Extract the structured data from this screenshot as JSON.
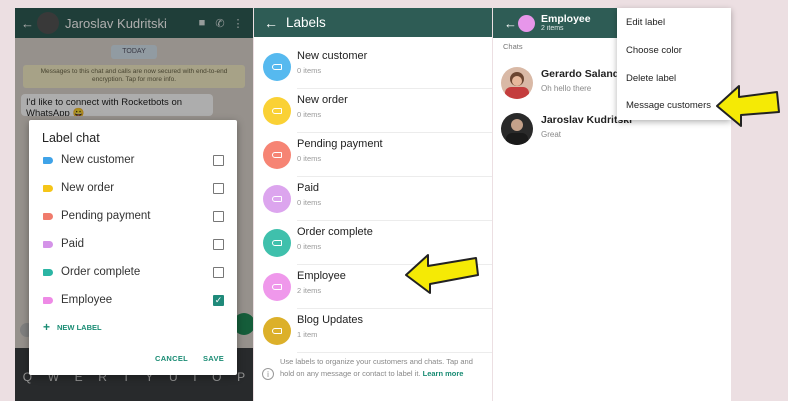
{
  "chat_screen": {
    "contact_name": "Jaroslav Kudritski",
    "date_chip": "TODAY",
    "encryption_notice": "Messages to this chat and calls are now secured with end-to-end encryption. Tap for more info.",
    "message": "I'd like to connect with Rocketbots on WhatsApp 😀",
    "keyboard_keys": [
      "Q",
      "W",
      "E",
      "R",
      "T",
      "Y",
      "U",
      "I",
      "O",
      "P"
    ]
  },
  "label_dialog": {
    "title": "Label chat",
    "labels": [
      {
        "name": "New customer",
        "color": "#3fa3e8",
        "checked": false
      },
      {
        "name": "New order",
        "color": "#f5c518",
        "checked": false
      },
      {
        "name": "Pending payment",
        "color": "#f07b6c",
        "checked": false
      },
      {
        "name": "Paid",
        "color": "#d493e8",
        "checked": false
      },
      {
        "name": "Order complete",
        "color": "#2bb5a4",
        "checked": false
      },
      {
        "name": "Employee",
        "color": "#ee8ae6",
        "checked": true
      }
    ],
    "new_label": "NEW LABEL",
    "cancel": "CANCEL",
    "save": "SAVE"
  },
  "labels_screen": {
    "title": "Labels",
    "items": [
      {
        "name": "New customer",
        "count": "0 items",
        "color": "#56b9ef"
      },
      {
        "name": "New order",
        "count": "0 items",
        "color": "#fad135"
      },
      {
        "name": "Pending payment",
        "count": "0 items",
        "color": "#f68474"
      },
      {
        "name": "Paid",
        "count": "0 items",
        "color": "#dca5ee"
      },
      {
        "name": "Order complete",
        "count": "0 items",
        "color": "#3fc0ac"
      },
      {
        "name": "Employee",
        "count": "2 items",
        "color": "#ef98eb"
      },
      {
        "name": "Blog Updates",
        "count": "1 item",
        "color": "#dcb02a"
      }
    ],
    "footer_text": "Use labels to organize your customers and chats. Tap and hold on any message or contact to label it.",
    "footer_link": "Learn more"
  },
  "employee_screen": {
    "title": "Employee",
    "subtitle": "2 items",
    "section": "Chats",
    "chats": [
      {
        "name": "Gerardo Salandra",
        "message": "Oh hello there"
      },
      {
        "name": "Jaroslav Kudritski",
        "message": "Great"
      }
    ]
  },
  "overflow_menu": {
    "items": [
      "Edit label",
      "Choose color",
      "Delete label",
      "Message customers"
    ]
  }
}
